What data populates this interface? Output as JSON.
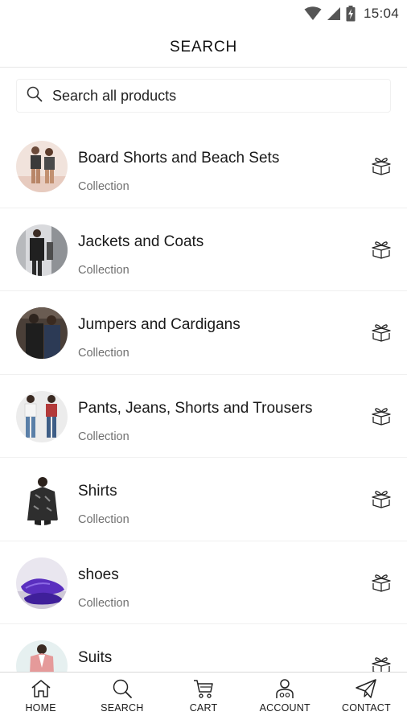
{
  "status_bar": {
    "time": "15:04",
    "icons": [
      "wifi-icon",
      "cell-signal-icon",
      "battery-charging-icon"
    ]
  },
  "header": {
    "title": "SEARCH"
  },
  "search": {
    "placeholder": "Search all products",
    "icon": "search-icon"
  },
  "collections": [
    {
      "title": "Board Shorts and Beach Sets",
      "subtitle": "Collection"
    },
    {
      "title": "Jackets and Coats",
      "subtitle": "Collection"
    },
    {
      "title": "Jumpers and Cardigans",
      "subtitle": "Collection"
    },
    {
      "title": "Pants, Jeans, Shorts and Trousers",
      "subtitle": "Collection"
    },
    {
      "title": "Shirts",
      "subtitle": "Collection"
    },
    {
      "title": "shoes",
      "subtitle": "Collection"
    },
    {
      "title": "Suits",
      "subtitle": ""
    }
  ],
  "item_icon": "gift-box-icon",
  "bottom_nav": [
    {
      "label": "HOME",
      "icon": "home-icon"
    },
    {
      "label": "SEARCH",
      "icon": "search-icon"
    },
    {
      "label": "CART",
      "icon": "cart-icon"
    },
    {
      "label": "ACCOUNT",
      "icon": "account-icon"
    },
    {
      "label": "CONTACT",
      "icon": "paper-plane-icon"
    }
  ],
  "colors": {
    "text": "#1a1a1a",
    "secondary_text": "#707070",
    "divider": "#f0f0f0",
    "background": "#ffffff"
  }
}
